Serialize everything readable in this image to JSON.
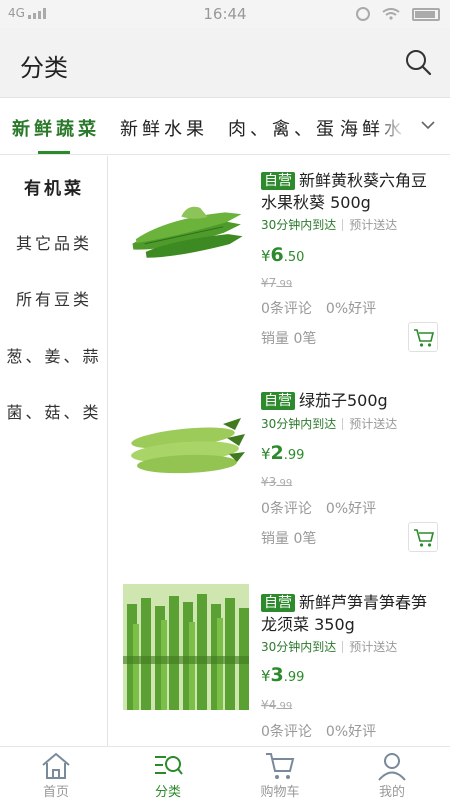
{
  "status_bar": {
    "network": "4G",
    "time": "16:44"
  },
  "header": {
    "title": "分类",
    "search_icon": "search-icon"
  },
  "tabs": [
    {
      "label": "新鲜蔬菜",
      "active": true
    },
    {
      "label": "新鲜水果",
      "active": false
    },
    {
      "label": "肉、禽、蛋",
      "active": false
    },
    {
      "label": "海鲜水",
      "active": false
    }
  ],
  "tabs_more_icon": "chevron-down-icon",
  "sidebar": {
    "items": [
      {
        "label": "有机菜",
        "active": true
      },
      {
        "label": "其它品类",
        "active": false
      },
      {
        "label": "所有豆类",
        "active": false
      },
      {
        "label": "葱、姜、蒜",
        "active": false
      },
      {
        "label": "菌、菇、类",
        "active": false
      }
    ]
  },
  "products": [
    {
      "badge": "自营",
      "name": "新鲜黄秋葵六角豆 水果秋葵 500g",
      "delivery": "30分钟内到达",
      "delivery_note": "预计送达",
      "currency": "¥",
      "price_int": "6",
      "price_dec": ".50",
      "old_price_int": "¥7",
      "old_price_dec": ".99",
      "reviews": "0条评论",
      "rating": "0%好评",
      "sales": "销量 0笔"
    },
    {
      "badge": "自营",
      "name": "绿茄子500g",
      "delivery": "30分钟内到达",
      "delivery_note": "预计送达",
      "currency": "¥",
      "price_int": "2",
      "price_dec": ".99",
      "old_price_int": "¥3",
      "old_price_dec": ".99",
      "reviews": "0条评论",
      "rating": "0%好评",
      "sales": "销量 0笔"
    },
    {
      "badge": "自营",
      "name": "新鲜芦笋青笋春笋龙须菜 350g",
      "delivery": "30分钟内到达",
      "delivery_note": "预计送达",
      "currency": "¥",
      "price_int": "3",
      "price_dec": ".99",
      "old_price_int": "¥4",
      "old_price_dec": ".99",
      "reviews": "0条评论",
      "rating": "0%好评"
    }
  ],
  "bottom_nav": [
    {
      "label": "首页",
      "icon": "home-icon",
      "active": false
    },
    {
      "label": "分类",
      "icon": "category-icon",
      "active": true
    },
    {
      "label": "购物车",
      "icon": "cart-icon",
      "active": false
    },
    {
      "label": "我的",
      "icon": "user-icon",
      "active": false
    }
  ],
  "colors": {
    "accent": "#2b8a2b",
    "muted": "#999999"
  }
}
